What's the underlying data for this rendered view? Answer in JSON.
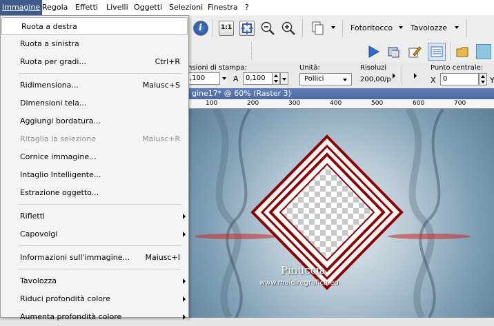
{
  "menubar": {
    "items": [
      {
        "label": "Immagine"
      },
      {
        "label": "Regola"
      },
      {
        "label": "Effetti"
      },
      {
        "label": "Livelli"
      },
      {
        "label": "Oggetti"
      },
      {
        "label": "Selezioni"
      },
      {
        "label": "Finestra"
      },
      {
        "label": "?"
      }
    ]
  },
  "toolbar": {
    "fotoritocco": "Fotoritocco",
    "tavolozze": "Tavolozze"
  },
  "props": {
    "dim_stampa_label": "nsioni di stampa:",
    "width_value": ",100",
    "a_label": "A",
    "height_value": "0,100",
    "unita_label": "Unità:",
    "unita_value": "Pollici",
    "risoluzione_label": "Risoluzi",
    "risoluzione_value": "200,00/p",
    "punto_label": "Punto centrale:",
    "x_label": "X",
    "x_value": "0",
    "y_label": "Y"
  },
  "canvas": {
    "title": "gine17* @ 60% (Raster 3)",
    "ruler_ticks": [
      "100",
      "200",
      "300",
      "400",
      "500",
      "600",
      "700"
    ],
    "watermark": "Pinuccia",
    "watermark_sub": "www.maidiregrafica.eu"
  },
  "dropdown": {
    "items": [
      {
        "label": "Ruota a destra",
        "shortcut": "",
        "submenu": false,
        "disabled": false
      },
      {
        "label": "Ruota a sinistra",
        "shortcut": "",
        "submenu": false,
        "disabled": false
      },
      {
        "label": "Ruota per gradi...",
        "shortcut": "Ctrl+R",
        "submenu": false,
        "disabled": false
      },
      {
        "label": "Ridimensiona...",
        "shortcut": "Maiusc+S",
        "submenu": false,
        "disabled": false
      },
      {
        "label": "Dimensioni tela...",
        "shortcut": "",
        "submenu": false,
        "disabled": false
      },
      {
        "label": "Aggiungi bordatura...",
        "shortcut": "",
        "submenu": false,
        "disabled": false
      },
      {
        "label": "Ritaglia la selezione",
        "shortcut": "Maiusc+R",
        "submenu": false,
        "disabled": true
      },
      {
        "label": "Cornice immagine...",
        "shortcut": "",
        "submenu": false,
        "disabled": false
      },
      {
        "label": "Intaglio Intelligente...",
        "shortcut": "",
        "submenu": false,
        "disabled": false
      },
      {
        "label": "Estrazione oggetto...",
        "shortcut": "",
        "submenu": false,
        "disabled": false
      },
      {
        "label": "Rifletti",
        "shortcut": "",
        "submenu": true,
        "disabled": false
      },
      {
        "label": "Capovolgi",
        "shortcut": "",
        "submenu": true,
        "disabled": false
      },
      {
        "label": "Informazioni sull'immagine...",
        "shortcut": "Maiusc+I",
        "submenu": false,
        "disabled": false
      },
      {
        "label": "Tavolozza",
        "shortcut": "",
        "submenu": true,
        "disabled": false
      },
      {
        "label": "Riduci profondità colore",
        "shortcut": "",
        "submenu": true,
        "disabled": false
      },
      {
        "label": "Aumenta profondità colore",
        "shortcut": "",
        "submenu": true,
        "disabled": false
      }
    ]
  },
  "colors": {
    "menu_active": "#3f5a8a",
    "frame_red": "#8b0000",
    "play_blue": "#2e6fc7"
  }
}
